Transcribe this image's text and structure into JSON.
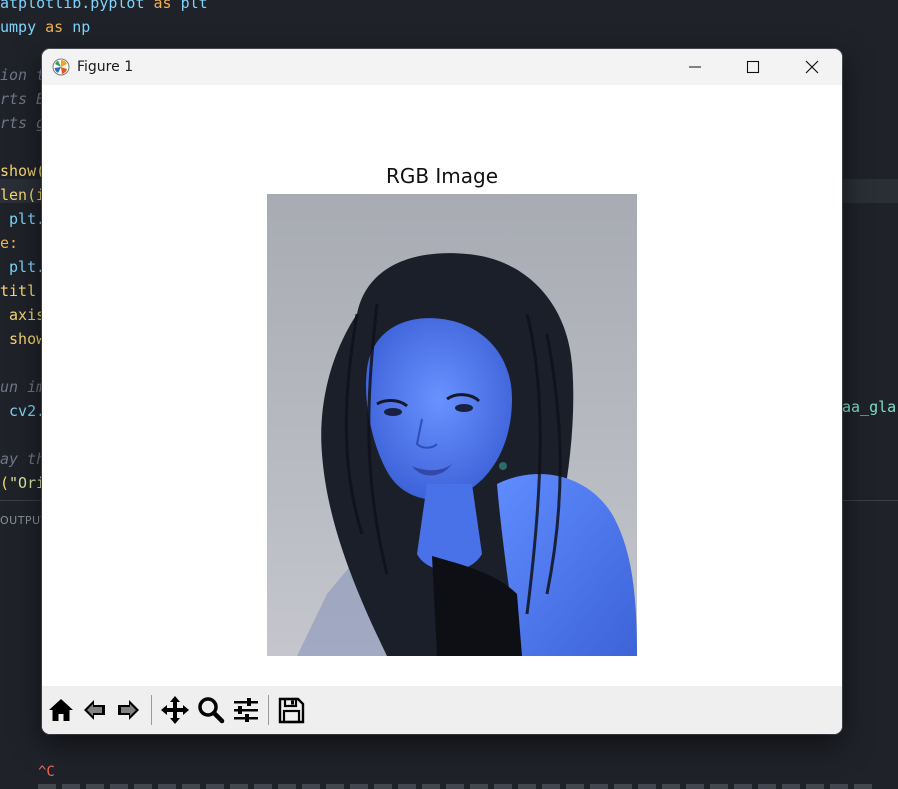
{
  "editor": {
    "lines": [
      {
        "tokens": [
          {
            "t": "atplotlib.pyplot ",
            "c": "c-mod"
          },
          {
            "t": "as ",
            "c": "c-kw"
          },
          {
            "t": "plt",
            "c": "c-mod"
          }
        ]
      },
      {
        "tokens": [
          {
            "t": "umpy ",
            "c": "c-mod"
          },
          {
            "t": "as ",
            "c": "c-kw"
          },
          {
            "t": "np",
            "c": "c-mod"
          }
        ]
      },
      {
        "tokens": []
      },
      {
        "tokens": [
          {
            "t": "ion t",
            "c": "c-com"
          }
        ]
      },
      {
        "tokens": [
          {
            "t": "rts B",
            "c": "c-com"
          }
        ]
      },
      {
        "tokens": [
          {
            "t": "rts g",
            "c": "c-com"
          }
        ]
      },
      {
        "tokens": []
      },
      {
        "tokens": [
          {
            "t": "show(",
            "c": "c-fn"
          }
        ]
      },
      {
        "tokens": [
          {
            "t": "len(i",
            "c": "c-fn"
          }
        ]
      },
      {
        "tokens": [
          {
            "t": " plt.",
            "c": "c-id"
          }
        ]
      },
      {
        "tokens": [
          {
            "t": "e:",
            "c": "c-kw"
          }
        ]
      },
      {
        "tokens": [
          {
            "t": " plt.",
            "c": "c-id"
          }
        ]
      },
      {
        "tokens": [
          {
            "t": "titl",
            "c": "c-fn"
          }
        ]
      },
      {
        "tokens": [
          {
            "t": " axis",
            "c": "c-fn"
          }
        ]
      },
      {
        "tokens": [
          {
            "t": " show",
            "c": "c-fn"
          }
        ]
      },
      {
        "tokens": []
      },
      {
        "tokens": [
          {
            "t": "un im",
            "c": "c-com"
          }
        ]
      },
      {
        "tokens": [
          {
            "t": " cv2.",
            "c": "c-id"
          }
        ]
      },
      {
        "tokens": []
      },
      {
        "tokens": [
          {
            "t": "ay th",
            "c": "c-com"
          }
        ]
      },
      {
        "tokens": [
          {
            "t": "(",
            "c": "c-fn"
          },
          {
            "t": "\"Ori",
            "c": "c-str"
          }
        ]
      }
    ],
    "right_fragment": "aa_gla",
    "output_label": "OUTPUT",
    "terminal_ctrl": "^C"
  },
  "window": {
    "title": "Figure 1",
    "minimize_label": "Minimize",
    "maximize_label": "Maximize",
    "close_label": "Close"
  },
  "plot": {
    "title": "RGB Image"
  },
  "toolbar": {
    "buttons": [
      {
        "name": "home-button",
        "icon": "home-icon"
      },
      {
        "name": "back-button",
        "icon": "arrow-left-icon"
      },
      {
        "name": "forward-button",
        "icon": "arrow-right-icon"
      },
      {
        "name": "pan-button",
        "icon": "move-icon"
      },
      {
        "name": "zoom-button",
        "icon": "magnifier-icon"
      },
      {
        "name": "configure-subplots-button",
        "icon": "sliders-icon"
      },
      {
        "name": "save-button",
        "icon": "floppy-disk-icon"
      }
    ]
  },
  "colors": {
    "editor_bg": "#1f2229",
    "window_bg": "#ffffff",
    "titlebar_bg": "#f3f3f3",
    "toolbar_bg": "#efefef",
    "skin_tint": "#4d78f0",
    "photo_bg": "#b9bcc4"
  }
}
